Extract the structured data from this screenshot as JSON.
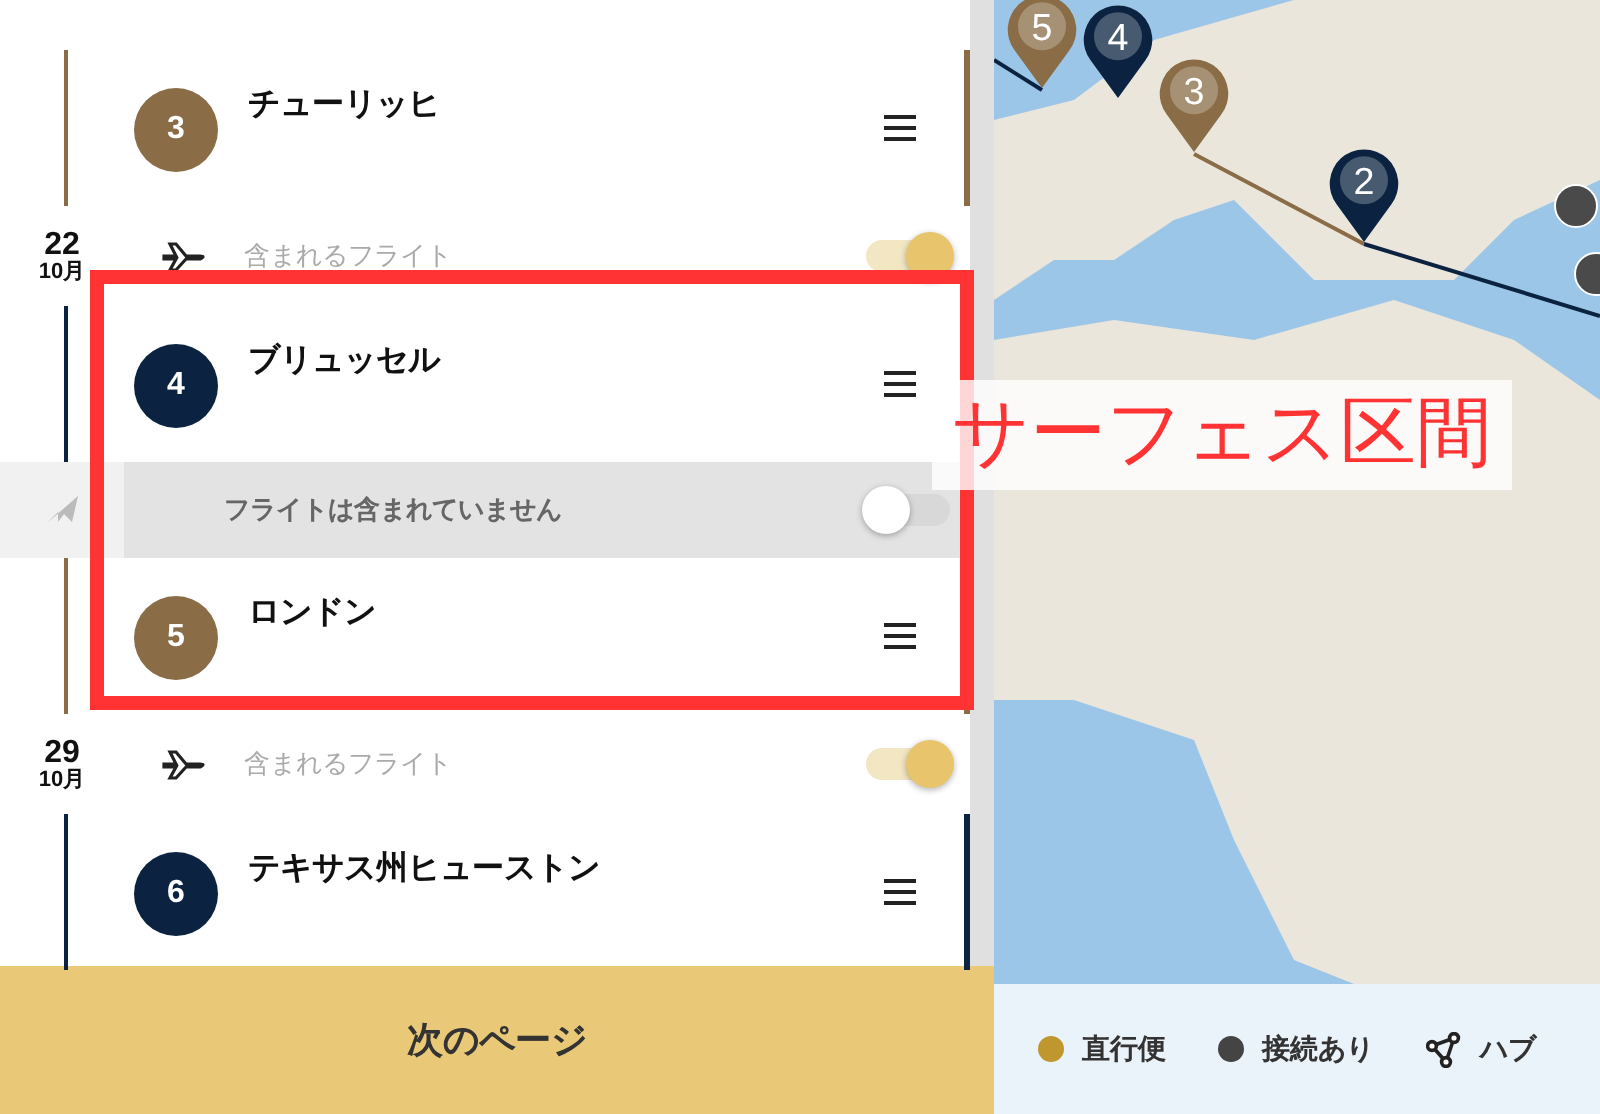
{
  "itinerary": [
    {
      "kind": "stop",
      "number": "3",
      "name": "チューリッヒ",
      "color": "#8a6d46"
    },
    {
      "kind": "flight",
      "day": "22",
      "month": "10月",
      "label": "含まれるフライト",
      "on": true
    },
    {
      "kind": "stop",
      "number": "4",
      "name": "ブリュッセル",
      "color": "#0b2340"
    },
    {
      "kind": "flight",
      "label": "フライトは含まれていません",
      "on": false
    },
    {
      "kind": "stop",
      "number": "5",
      "name": "ロンドン",
      "color": "#8a6d46"
    },
    {
      "kind": "flight",
      "day": "29",
      "month": "10月",
      "label": "含まれるフライト",
      "on": true
    },
    {
      "kind": "stop",
      "number": "6",
      "name": "テキサス州ヒューストン",
      "color": "#0b2340"
    }
  ],
  "next_button": "次のページ",
  "annotation": {
    "label": "サーフェス区間"
  },
  "map": {
    "pins": [
      {
        "label": "5",
        "color": "#8a6d46"
      },
      {
        "label": "4",
        "color": "#0b2340"
      },
      {
        "label": "3",
        "color": "#8a6d46"
      },
      {
        "label": "2",
        "color": "#0b2340"
      }
    ],
    "legend": [
      {
        "kind": "dot",
        "label": "直行便",
        "color": "#c0962e"
      },
      {
        "kind": "dot",
        "label": "接続あり",
        "color": "#444444"
      },
      {
        "kind": "hub",
        "label": "ハブ"
      }
    ]
  }
}
